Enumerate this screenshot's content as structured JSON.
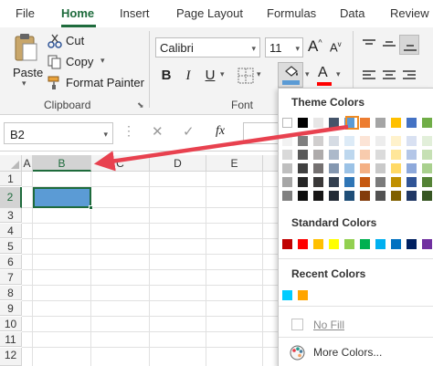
{
  "tabs": [
    {
      "label": "File",
      "active": false
    },
    {
      "label": "Home",
      "active": true
    },
    {
      "label": "Insert",
      "active": false
    },
    {
      "label": "Page Layout",
      "active": false
    },
    {
      "label": "Formulas",
      "active": false
    },
    {
      "label": "Data",
      "active": false
    },
    {
      "label": "Review",
      "active": false
    }
  ],
  "clipboard": {
    "paste_label": "Paste",
    "cut_label": "Cut",
    "copy_label": "Copy",
    "format_painter_label": "Format Painter",
    "group_label": "Clipboard"
  },
  "font": {
    "name": "Calibri",
    "size": "11",
    "bold": "B",
    "italic": "I",
    "underline": "U",
    "grow_glyph": "A",
    "font_color_glyph": "A",
    "group_label": "Font"
  },
  "colors": {
    "accent_green": "#1e6b3c",
    "fill_selected": "#5b9bd5",
    "arrow_red": "#e8414f",
    "highlight_orange": "#f08c24"
  },
  "formula_bar": {
    "name_box": "B2",
    "fx_label": "fx"
  },
  "grid": {
    "columns": [
      "A",
      "B",
      "C",
      "D",
      "E"
    ],
    "rows": [
      "1",
      "2",
      "3",
      "4",
      "5",
      "6",
      "7",
      "8",
      "9",
      "10",
      "11",
      "12"
    ],
    "selected_column": "B",
    "selected_row": "2"
  },
  "palette": {
    "theme_heading": "Theme Colors",
    "theme_top": [
      "#ffffff",
      "#000000",
      "#e7e6e6",
      "#44546a",
      "#5b9bd5",
      "#ed7d31",
      "#a5a5a5",
      "#ffc000",
      "#4472c4",
      "#70ad47"
    ],
    "theme_shades": [
      [
        "#f2f2f2",
        "#d9d9d9",
        "#bfbfbf",
        "#a6a6a6",
        "#808080"
      ],
      [
        "#7f7f7f",
        "#595959",
        "#404040",
        "#262626",
        "#0d0d0d"
      ],
      [
        "#d0cece",
        "#aeabab",
        "#757171",
        "#3a3838",
        "#171616"
      ],
      [
        "#d6dce4",
        "#acb9ca",
        "#8497b0",
        "#333f4f",
        "#222a35"
      ],
      [
        "#ddebf7",
        "#bdd7ee",
        "#9bc2e6",
        "#2f75b5",
        "#1f4e78"
      ],
      [
        "#fce4d6",
        "#f8cbad",
        "#f4b084",
        "#c65911",
        "#833c0c"
      ],
      [
        "#ededed",
        "#dbdbdb",
        "#c9c9c9",
        "#7b7b7b",
        "#525252"
      ],
      [
        "#fff2cc",
        "#ffe699",
        "#ffd966",
        "#bf8f00",
        "#806000"
      ],
      [
        "#d9e1f2",
        "#b4c6e7",
        "#8ea9db",
        "#305496",
        "#203764"
      ],
      [
        "#e2efda",
        "#c6e0b4",
        "#a9d08e",
        "#548235",
        "#375623"
      ]
    ],
    "standard_heading": "Standard Colors",
    "standard": [
      "#c00000",
      "#ff0000",
      "#ffc000",
      "#ffff00",
      "#92d050",
      "#00b050",
      "#00b0f0",
      "#0070c0",
      "#002060",
      "#7030a0"
    ],
    "recent_heading": "Recent Colors",
    "recent": [
      "#00ccff",
      "#ffa500"
    ],
    "no_fill_label": "No Fill",
    "more_colors_label": "More Colors..."
  }
}
